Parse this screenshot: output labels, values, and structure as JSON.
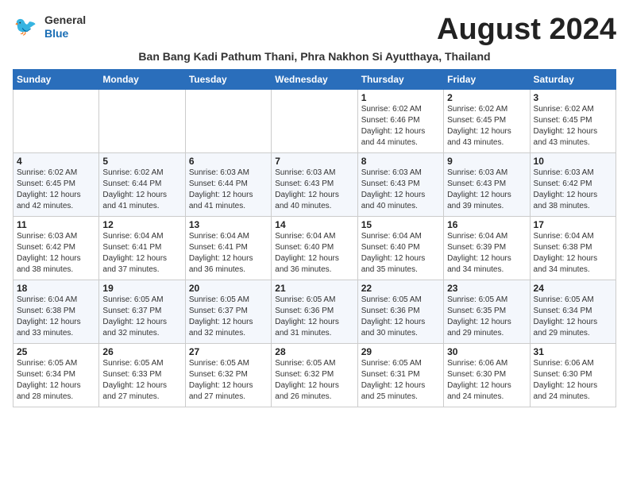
{
  "header": {
    "logo_line1": "General",
    "logo_line2": "Blue",
    "month_year": "August 2024",
    "subtitle": "Ban Bang Kadi Pathum Thani, Phra Nakhon Si Ayutthaya, Thailand"
  },
  "weekdays": [
    "Sunday",
    "Monday",
    "Tuesday",
    "Wednesday",
    "Thursday",
    "Friday",
    "Saturday"
  ],
  "weeks": [
    [
      {
        "day": "",
        "info": ""
      },
      {
        "day": "",
        "info": ""
      },
      {
        "day": "",
        "info": ""
      },
      {
        "day": "",
        "info": ""
      },
      {
        "day": "1",
        "info": "Sunrise: 6:02 AM\nSunset: 6:46 PM\nDaylight: 12 hours\nand 44 minutes."
      },
      {
        "day": "2",
        "info": "Sunrise: 6:02 AM\nSunset: 6:45 PM\nDaylight: 12 hours\nand 43 minutes."
      },
      {
        "day": "3",
        "info": "Sunrise: 6:02 AM\nSunset: 6:45 PM\nDaylight: 12 hours\nand 43 minutes."
      }
    ],
    [
      {
        "day": "4",
        "info": "Sunrise: 6:02 AM\nSunset: 6:45 PM\nDaylight: 12 hours\nand 42 minutes."
      },
      {
        "day": "5",
        "info": "Sunrise: 6:02 AM\nSunset: 6:44 PM\nDaylight: 12 hours\nand 41 minutes."
      },
      {
        "day": "6",
        "info": "Sunrise: 6:03 AM\nSunset: 6:44 PM\nDaylight: 12 hours\nand 41 minutes."
      },
      {
        "day": "7",
        "info": "Sunrise: 6:03 AM\nSunset: 6:43 PM\nDaylight: 12 hours\nand 40 minutes."
      },
      {
        "day": "8",
        "info": "Sunrise: 6:03 AM\nSunset: 6:43 PM\nDaylight: 12 hours\nand 40 minutes."
      },
      {
        "day": "9",
        "info": "Sunrise: 6:03 AM\nSunset: 6:43 PM\nDaylight: 12 hours\nand 39 minutes."
      },
      {
        "day": "10",
        "info": "Sunrise: 6:03 AM\nSunset: 6:42 PM\nDaylight: 12 hours\nand 38 minutes."
      }
    ],
    [
      {
        "day": "11",
        "info": "Sunrise: 6:03 AM\nSunset: 6:42 PM\nDaylight: 12 hours\nand 38 minutes."
      },
      {
        "day": "12",
        "info": "Sunrise: 6:04 AM\nSunset: 6:41 PM\nDaylight: 12 hours\nand 37 minutes."
      },
      {
        "day": "13",
        "info": "Sunrise: 6:04 AM\nSunset: 6:41 PM\nDaylight: 12 hours\nand 36 minutes."
      },
      {
        "day": "14",
        "info": "Sunrise: 6:04 AM\nSunset: 6:40 PM\nDaylight: 12 hours\nand 36 minutes."
      },
      {
        "day": "15",
        "info": "Sunrise: 6:04 AM\nSunset: 6:40 PM\nDaylight: 12 hours\nand 35 minutes."
      },
      {
        "day": "16",
        "info": "Sunrise: 6:04 AM\nSunset: 6:39 PM\nDaylight: 12 hours\nand 34 minutes."
      },
      {
        "day": "17",
        "info": "Sunrise: 6:04 AM\nSunset: 6:38 PM\nDaylight: 12 hours\nand 34 minutes."
      }
    ],
    [
      {
        "day": "18",
        "info": "Sunrise: 6:04 AM\nSunset: 6:38 PM\nDaylight: 12 hours\nand 33 minutes."
      },
      {
        "day": "19",
        "info": "Sunrise: 6:05 AM\nSunset: 6:37 PM\nDaylight: 12 hours\nand 32 minutes."
      },
      {
        "day": "20",
        "info": "Sunrise: 6:05 AM\nSunset: 6:37 PM\nDaylight: 12 hours\nand 32 minutes."
      },
      {
        "day": "21",
        "info": "Sunrise: 6:05 AM\nSunset: 6:36 PM\nDaylight: 12 hours\nand 31 minutes."
      },
      {
        "day": "22",
        "info": "Sunrise: 6:05 AM\nSunset: 6:36 PM\nDaylight: 12 hours\nand 30 minutes."
      },
      {
        "day": "23",
        "info": "Sunrise: 6:05 AM\nSunset: 6:35 PM\nDaylight: 12 hours\nand 29 minutes."
      },
      {
        "day": "24",
        "info": "Sunrise: 6:05 AM\nSunset: 6:34 PM\nDaylight: 12 hours\nand 29 minutes."
      }
    ],
    [
      {
        "day": "25",
        "info": "Sunrise: 6:05 AM\nSunset: 6:34 PM\nDaylight: 12 hours\nand 28 minutes."
      },
      {
        "day": "26",
        "info": "Sunrise: 6:05 AM\nSunset: 6:33 PM\nDaylight: 12 hours\nand 27 minutes."
      },
      {
        "day": "27",
        "info": "Sunrise: 6:05 AM\nSunset: 6:32 PM\nDaylight: 12 hours\nand 27 minutes."
      },
      {
        "day": "28",
        "info": "Sunrise: 6:05 AM\nSunset: 6:32 PM\nDaylight: 12 hours\nand 26 minutes."
      },
      {
        "day": "29",
        "info": "Sunrise: 6:05 AM\nSunset: 6:31 PM\nDaylight: 12 hours\nand 25 minutes."
      },
      {
        "day": "30",
        "info": "Sunrise: 6:06 AM\nSunset: 6:30 PM\nDaylight: 12 hours\nand 24 minutes."
      },
      {
        "day": "31",
        "info": "Sunrise: 6:06 AM\nSunset: 6:30 PM\nDaylight: 12 hours\nand 24 minutes."
      }
    ]
  ]
}
